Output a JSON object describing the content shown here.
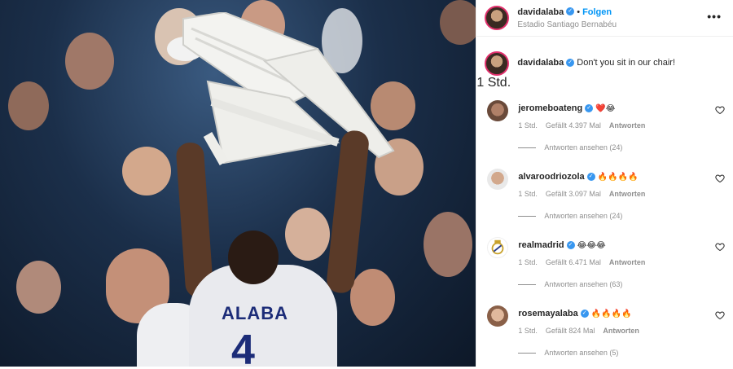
{
  "header": {
    "username": "davidalaba",
    "follow_label": "Folgen",
    "location": "Estadio Santiago Bernabéu",
    "more_label": "•••"
  },
  "jersey": {
    "name": "ALABA",
    "number": "4"
  },
  "caption": {
    "username": "davidalaba",
    "text": "Don't you sit in our chair!",
    "time": "1 Std."
  },
  "comments": [
    {
      "username": "jeromeboateng",
      "text": "❤️😂",
      "time": "1 Std.",
      "likes": "Gefällt 4.397 Mal",
      "reply": "Antworten",
      "view_replies": "Antworten ansehen (24)"
    },
    {
      "username": "alvaroodriozola",
      "text": "🔥🔥🔥🔥",
      "time": "1 Std.",
      "likes": "Gefällt 3.097 Mal",
      "reply": "Antworten",
      "view_replies": "Antworten ansehen (24)"
    },
    {
      "username": "realmadrid",
      "text": "😂😂😂",
      "time": "1 Std.",
      "likes": "Gefällt 6.471 Mal",
      "reply": "Antworten",
      "view_replies": "Antworten ansehen (63)"
    },
    {
      "username": "rosemayalaba",
      "text": "🔥🔥🔥🔥",
      "time": "1 Std.",
      "likes": "Gefällt 824 Mal",
      "reply": "Antworten",
      "view_replies": "Antworten ansehen (5)"
    }
  ],
  "colors": {
    "accent": "#0095f6",
    "verified": "#3897f0",
    "jersey_text": "#1c2c78"
  },
  "icons": [
    "verified-badge-icon",
    "more-options-icon",
    "heart-icon"
  ]
}
